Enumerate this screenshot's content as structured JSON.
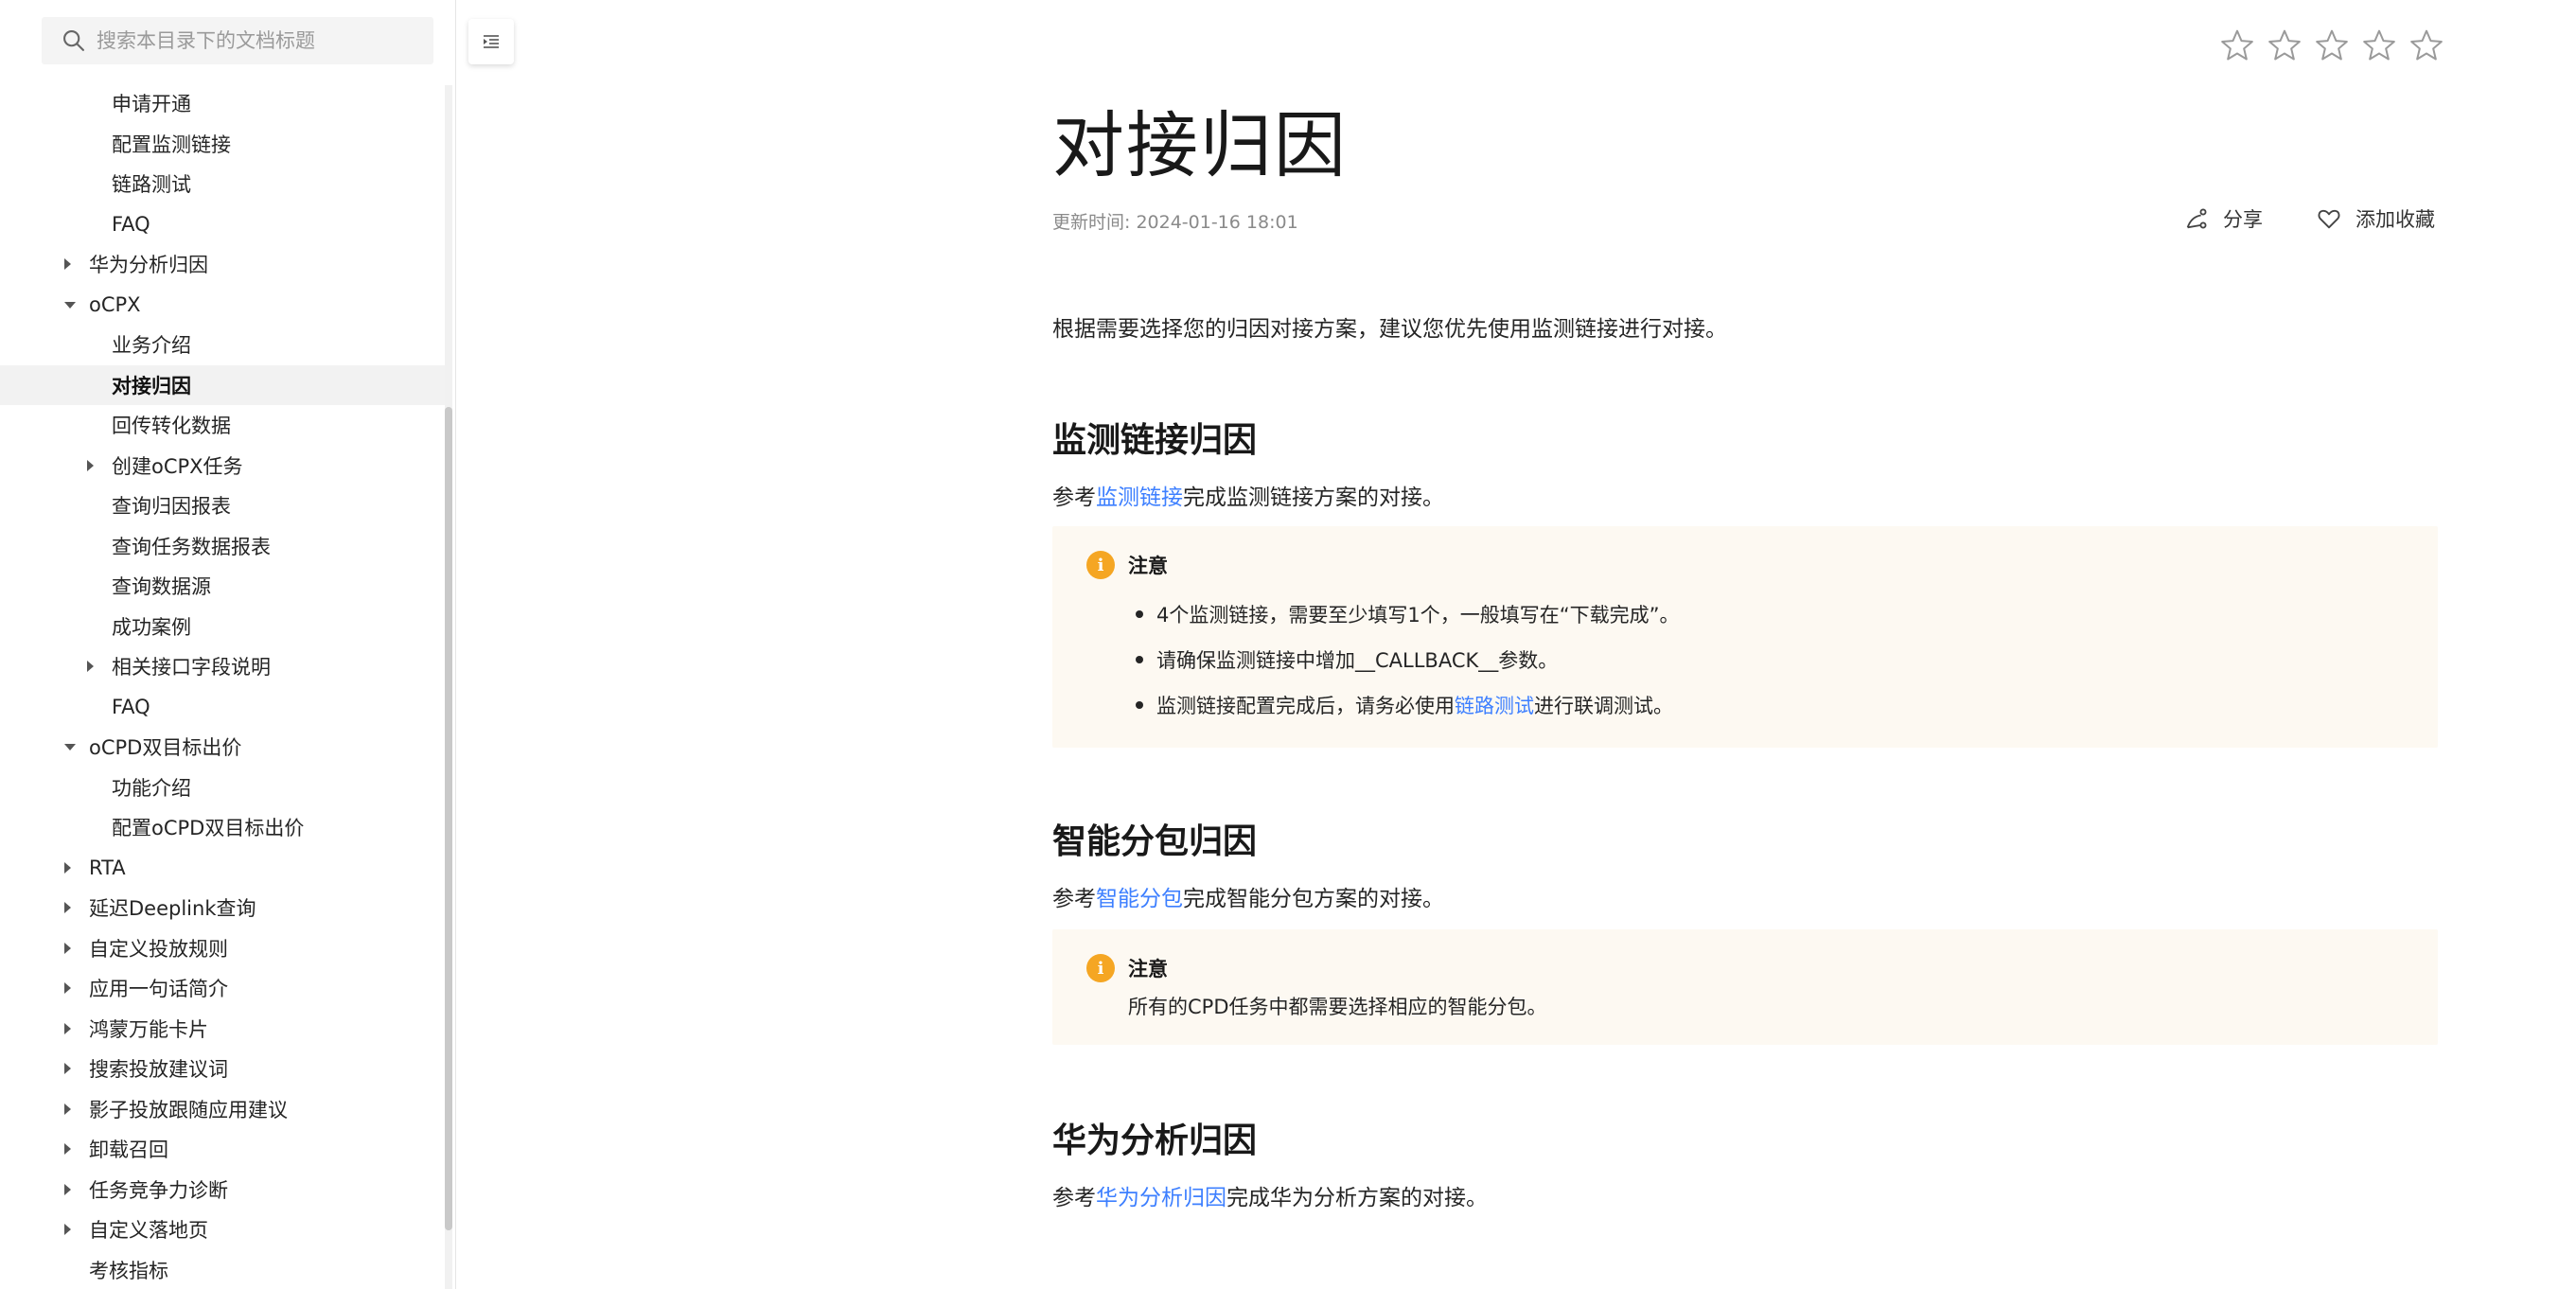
{
  "sidebar": {
    "search_placeholder": "搜索本目录下的文档标题",
    "items": [
      {
        "label": "申请开通",
        "level": 2,
        "caret": "none",
        "active": false
      },
      {
        "label": "配置监测链接",
        "level": 2,
        "caret": "none",
        "active": false
      },
      {
        "label": "链路测试",
        "level": 2,
        "caret": "none",
        "active": false
      },
      {
        "label": "FAQ",
        "level": 2,
        "caret": "none",
        "active": false
      },
      {
        "label": "华为分析归因",
        "level": 1,
        "caret": "right",
        "active": false
      },
      {
        "label": "oCPX",
        "level": 1,
        "caret": "down",
        "active": false
      },
      {
        "label": "业务介绍",
        "level": 2,
        "caret": "none",
        "active": false
      },
      {
        "label": "对接归因",
        "level": 2,
        "caret": "none",
        "active": true
      },
      {
        "label": "回传转化数据",
        "level": 2,
        "caret": "none",
        "active": false
      },
      {
        "label": "创建oCPX任务",
        "level": 2,
        "caret": "right",
        "active": false
      },
      {
        "label": "查询归因报表",
        "level": 2,
        "caret": "none",
        "active": false
      },
      {
        "label": "查询任务数据报表",
        "level": 2,
        "caret": "none",
        "active": false
      },
      {
        "label": "查询数据源",
        "level": 2,
        "caret": "none",
        "active": false
      },
      {
        "label": "成功案例",
        "level": 2,
        "caret": "none",
        "active": false
      },
      {
        "label": "相关接口字段说明",
        "level": 2,
        "caret": "right",
        "active": false
      },
      {
        "label": "FAQ",
        "level": 2,
        "caret": "none",
        "active": false
      },
      {
        "label": "oCPD双目标出价",
        "level": 1,
        "caret": "down",
        "active": false
      },
      {
        "label": "功能介绍",
        "level": 2,
        "caret": "none",
        "active": false
      },
      {
        "label": "配置oCPD双目标出价",
        "level": 2,
        "caret": "none",
        "active": false
      },
      {
        "label": "RTA",
        "level": 1,
        "caret": "right",
        "active": false
      },
      {
        "label": "延迟Deeplink查询",
        "level": 1,
        "caret": "right",
        "active": false
      },
      {
        "label": "自定义投放规则",
        "level": 1,
        "caret": "right",
        "active": false
      },
      {
        "label": "应用一句话简介",
        "level": 1,
        "caret": "right",
        "active": false
      },
      {
        "label": "鸿蒙万能卡片",
        "level": 1,
        "caret": "right",
        "active": false
      },
      {
        "label": "搜索投放建议词",
        "level": 1,
        "caret": "right",
        "active": false
      },
      {
        "label": "影子投放跟随应用建议",
        "level": 1,
        "caret": "right",
        "active": false
      },
      {
        "label": "卸载召回",
        "level": 1,
        "caret": "right",
        "active": false
      },
      {
        "label": "任务竞争力诊断",
        "level": 1,
        "caret": "right",
        "active": false
      },
      {
        "label": "自定义落地页",
        "level": 1,
        "caret": "right",
        "active": false
      },
      {
        "label": "考核指标",
        "level": 1,
        "caret": "none",
        "active": false
      }
    ]
  },
  "page": {
    "title": "对接归因",
    "updated": "更新时间: 2024-01-16 18:01",
    "share_label": "分享",
    "favorite_label": "添加收藏",
    "rating": 0,
    "intro": "根据需要选择您的归因对接方案，建议您优先使用监测链接进行对接。"
  },
  "sections": {
    "s1": {
      "heading": "监测链接归因",
      "ref_prefix": "参考",
      "ref_link": "监测链接",
      "ref_suffix": "完成监测链接方案的对接。",
      "note_title": "注意",
      "bullets": {
        "b1": "4个监测链接，需要至少填写1个，一般填写在“下载完成”。",
        "b2": "请确保监测链接中增加__CALLBACK__参数。",
        "b3_prefix": "监测链接配置完成后，请务必使用",
        "b3_link": "链路测试",
        "b3_suffix": "进行联调测试。"
      }
    },
    "s2": {
      "heading": "智能分包归因",
      "ref_prefix": "参考",
      "ref_link": "智能分包",
      "ref_suffix": "完成智能分包方案的对接。",
      "note_title": "注意",
      "note_text": "所有的CPD任务中都需要选择相应的智能分包。"
    },
    "s3": {
      "heading": "华为分析归因",
      "ref_prefix": "参考",
      "ref_link": "华为分析归因",
      "ref_suffix": "完成华为分析方案的对接。"
    }
  },
  "colors": {
    "link": "#3d7fff",
    "note_bg": "#fdf9f2",
    "note_icon": "#f5a623",
    "active_bg": "#f2f2f2"
  }
}
